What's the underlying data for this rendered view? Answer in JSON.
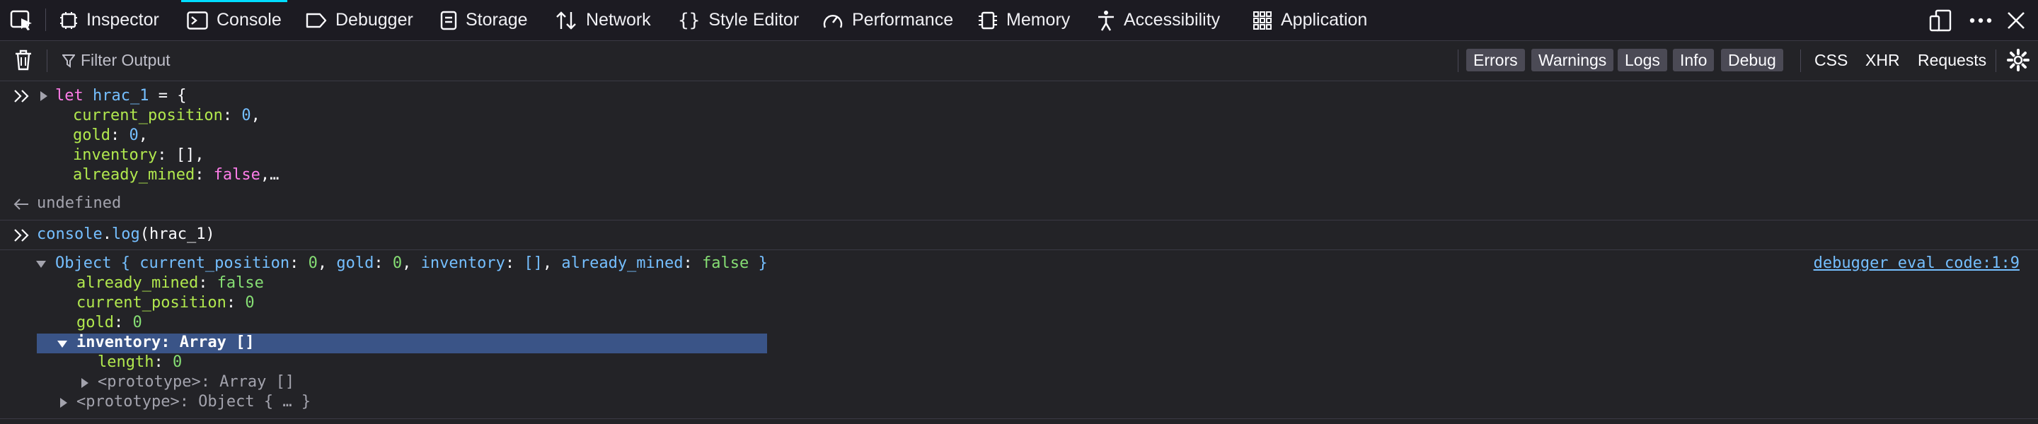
{
  "tabs": [
    {
      "label": "Inspector",
      "icon": "inspector-icon"
    },
    {
      "label": "Console",
      "icon": "console-icon",
      "active": true
    },
    {
      "label": "Debugger",
      "icon": "debugger-icon"
    },
    {
      "label": "Storage",
      "icon": "storage-icon"
    },
    {
      "label": "Network",
      "icon": "network-icon"
    },
    {
      "label": "Style Editor",
      "icon": "style-editor-icon"
    },
    {
      "label": "Performance",
      "icon": "performance-icon"
    },
    {
      "label": "Memory",
      "icon": "memory-icon"
    },
    {
      "label": "Accessibility",
      "icon": "accessibility-icon"
    },
    {
      "label": "Application",
      "icon": "application-icon"
    }
  ],
  "toolbar": {
    "filter_placeholder": "Filter Output",
    "levels": [
      "Errors",
      "Warnings",
      "Logs",
      "Info",
      "Debug"
    ],
    "types": [
      "CSS",
      "XHR",
      "Requests"
    ]
  },
  "console": {
    "input1": {
      "line1": {
        "kw": "let",
        "name": "hrac_1",
        "rest": " = {"
      },
      "line2": {
        "prop": "current_position",
        "sep": ": ",
        "val": "0",
        "end": ","
      },
      "line3": {
        "prop": "gold",
        "sep": ": ",
        "val": "0",
        "end": ","
      },
      "line4": {
        "prop": "inventory",
        "sep": ": ",
        "val": "[]",
        "end": ","
      },
      "line5": {
        "prop": "already_mined",
        "sep": ": ",
        "val": "false",
        "end": ",…"
      }
    },
    "result1": "undefined",
    "input2": {
      "obj": "console",
      "dot": ".",
      "fn": "log",
      "args": "(hrac_1)"
    },
    "log": {
      "summary": {
        "head": "Object { ",
        "p1": "current_position",
        "v1": "0",
        "p2": "gold",
        "v2": "0",
        "p3": "inventory",
        "v3": "[]",
        "p4": "already_mined",
        "v4": "false",
        "tail": " }"
      },
      "props": [
        {
          "name": "already_mined",
          "value": "false"
        },
        {
          "name": "current_position",
          "value": "0"
        },
        {
          "name": "gold",
          "value": "0"
        }
      ],
      "inventory_row": "inventory: Array []",
      "length_prop": "length",
      "length_val": "0",
      "proto_array": "<prototype>: Array []",
      "proto_object": "<prototype>: Object { … }",
      "source": "debugger eval code:1:9"
    }
  },
  "colors": {
    "accent": "#00ddff",
    "selection": "#3a5487",
    "background": "#232327"
  }
}
